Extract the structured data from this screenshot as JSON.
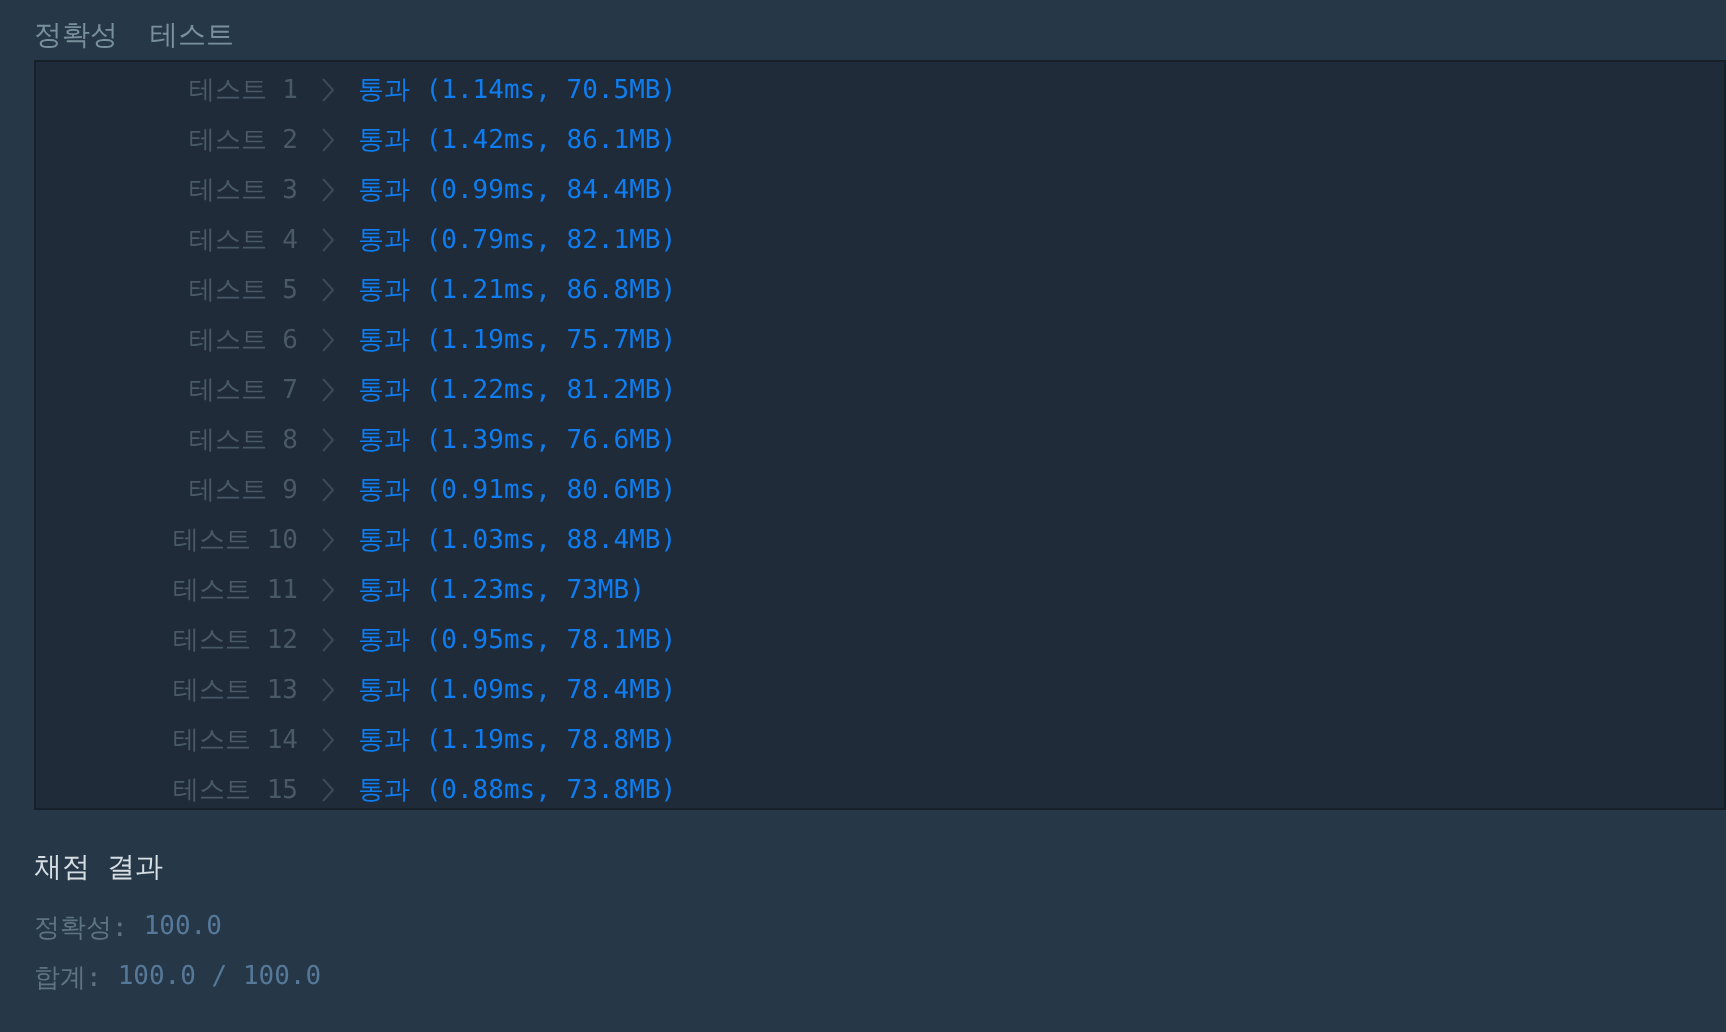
{
  "header": {
    "tabs": [
      "정확성",
      "테스트"
    ]
  },
  "tests": [
    {
      "label": "테스트 1",
      "result": "통과 (1.14ms, 70.5MB)"
    },
    {
      "label": "테스트 2",
      "result": "통과 (1.42ms, 86.1MB)"
    },
    {
      "label": "테스트 3",
      "result": "통과 (0.99ms, 84.4MB)"
    },
    {
      "label": "테스트 4",
      "result": "통과 (0.79ms, 82.1MB)"
    },
    {
      "label": "테스트 5",
      "result": "통과 (1.21ms, 86.8MB)"
    },
    {
      "label": "테스트 6",
      "result": "통과 (1.19ms, 75.7MB)"
    },
    {
      "label": "테스트 7",
      "result": "통과 (1.22ms, 81.2MB)"
    },
    {
      "label": "테스트 8",
      "result": "통과 (1.39ms, 76.6MB)"
    },
    {
      "label": "테스트 9",
      "result": "통과 (0.91ms, 80.6MB)"
    },
    {
      "label": "테스트 10",
      "result": "통과 (1.03ms, 88.4MB)"
    },
    {
      "label": "테스트 11",
      "result": "통과 (1.23ms, 73MB)"
    },
    {
      "label": "테스트 12",
      "result": "통과 (0.95ms, 78.1MB)"
    },
    {
      "label": "테스트 13",
      "result": "통과 (1.09ms, 78.4MB)"
    },
    {
      "label": "테스트 14",
      "result": "통과 (1.19ms, 78.8MB)"
    },
    {
      "label": "테스트 15",
      "result": "통과 (0.88ms, 73.8MB)"
    }
  ],
  "summary": {
    "title": "채점 결과",
    "lines": [
      {
        "label": "정확성:",
        "value": "100.0"
      },
      {
        "label": "합계:",
        "value": "100.0 / 100.0"
      }
    ]
  }
}
